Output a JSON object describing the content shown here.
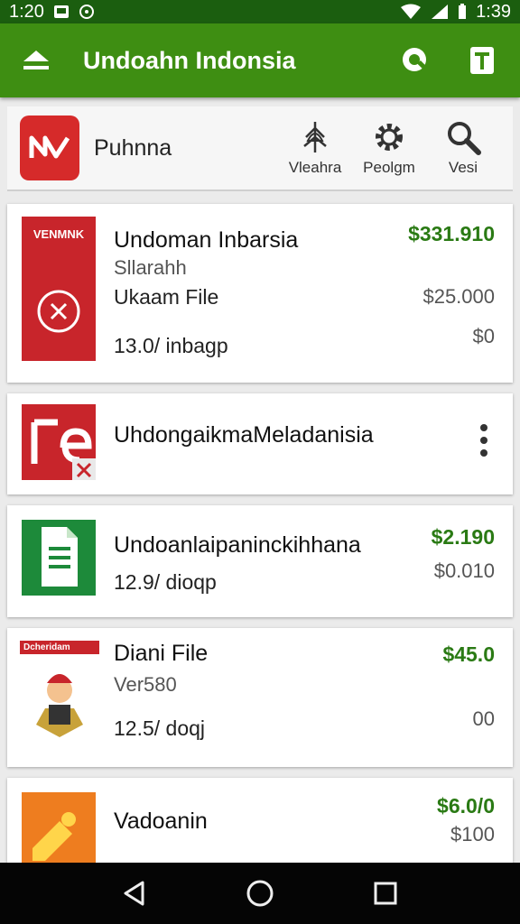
{
  "status_bar": {
    "time_left": "1:20",
    "time_right": "1:39"
  },
  "app_bar": {
    "title": "Undoahn Indonsia"
  },
  "header": {
    "title": "Puhnna",
    "tools": [
      {
        "label": "Vleahra",
        "icon": "tree-icon"
      },
      {
        "label": "Peolgm",
        "icon": "gear-icon"
      },
      {
        "label": "Vesi",
        "icon": "search-icon"
      }
    ]
  },
  "items": [
    {
      "name": "Undoman Inbarsia",
      "subtitle": "Sllarahh",
      "file_label": "Ukaam File",
      "meta": "13.0/ inbagp",
      "price": "$331.910",
      "price2": "$25.000",
      "price3": "$0",
      "thumb_text": "VENMNK"
    },
    {
      "name": "UhdongaikmaMeladanisia"
    },
    {
      "name": "Undoanlaipaninckihhana",
      "meta": "12.9/ dioqp",
      "price": "$2.190",
      "price2": "$0.010"
    },
    {
      "name": "Diani File",
      "subtitle": "Ver580",
      "meta": "12.5/ doqj",
      "price": "$45.0",
      "price2": "00",
      "thumb_text": "Dcheridam"
    },
    {
      "name": "Vadoanin",
      "price": "$6.0/0",
      "price2": "$100"
    }
  ],
  "colors": {
    "app_bar": "#3e8e12",
    "status_bar": "#1b5e0f",
    "price": "#2a7a14",
    "brand_red": "#d62a2a"
  }
}
